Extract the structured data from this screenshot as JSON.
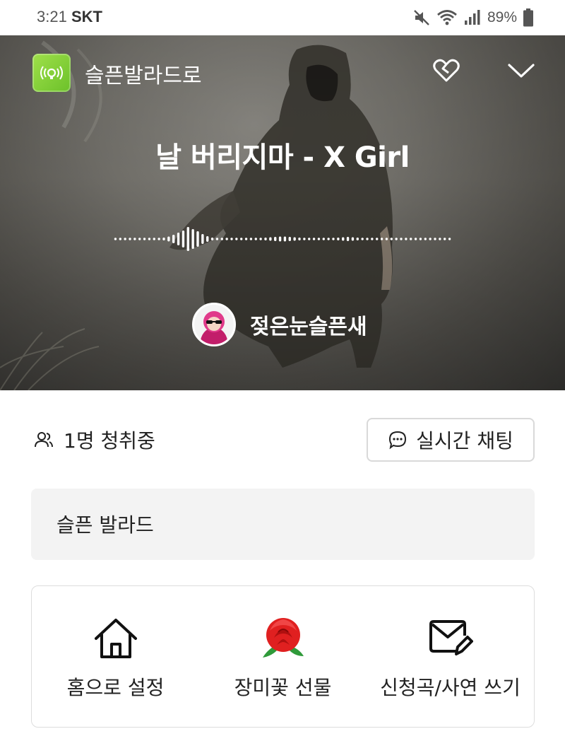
{
  "status_bar": {
    "time": "3:21",
    "carrier": "SKT",
    "battery": "89%",
    "icons": [
      "mute-icon",
      "wifi-icon",
      "signal-icon",
      "battery-icon"
    ]
  },
  "header": {
    "channel_name": "슬픈발라드로",
    "channel_icon": "broadcast-icon",
    "accent": "#7fd03a"
  },
  "now_playing": {
    "song_title": "날 버리지마 - X Girl",
    "dj_name": "젖은눈슬픈새"
  },
  "listeners": {
    "text": "1명 청취중"
  },
  "chat_button": {
    "label": "실시간 채팅"
  },
  "description": {
    "text": "슬픈 발라드"
  },
  "actions": [
    {
      "label": "홈으로 설정",
      "icon": "home-icon"
    },
    {
      "label": "장미꽃 선물",
      "icon": "rose-icon"
    },
    {
      "label": "신청곡/사연 쓰기",
      "icon": "mail-edit-icon"
    }
  ]
}
